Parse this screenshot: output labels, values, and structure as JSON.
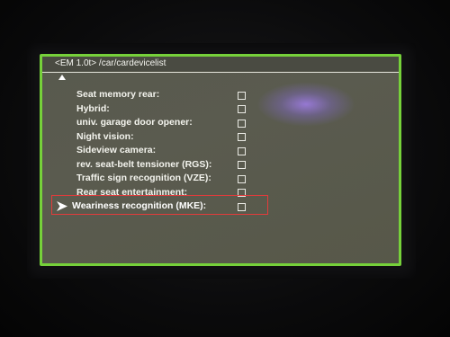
{
  "screen": {
    "title": "<EM 1.0t>  /car/cardevicelist",
    "accent_color": "#76d13a",
    "background_color": "#58594e",
    "scroll_indicator_icon": "triangle-up-icon"
  },
  "device_list": [
    {
      "label": "Seat memory rear:",
      "checked": false
    },
    {
      "label": "Hybrid:",
      "checked": false
    },
    {
      "label": "univ. garage door opener:",
      "checked": false
    },
    {
      "label": "Night vision:",
      "checked": false
    },
    {
      "label": "Sideview camera:",
      "checked": false
    },
    {
      "label": "rev. seat-belt tensioner (RGS):",
      "checked": false
    },
    {
      "label": "Traffic sign recognition (VZE):",
      "checked": false
    },
    {
      "label": "Rear seat entertainment:",
      "checked": false
    },
    {
      "label": "Weariness recognition (MKE):",
      "checked": false,
      "selected": true,
      "pointer_icon": "pointer-arrow-icon"
    }
  ],
  "annotation": {
    "type": "highlight-box",
    "color": "#e33b3b",
    "target": "Weariness recognition (MKE):"
  }
}
